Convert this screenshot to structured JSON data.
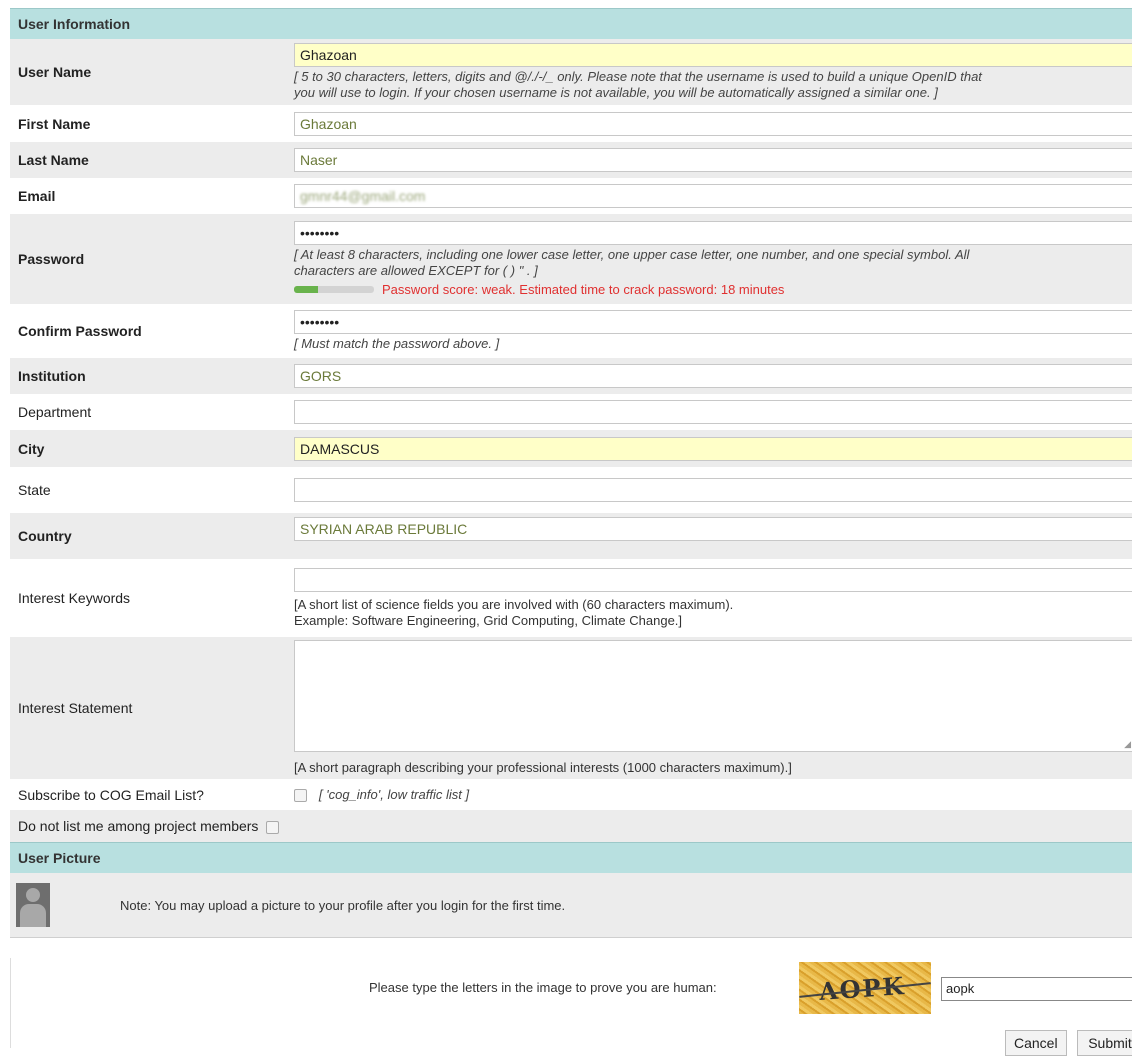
{
  "sections": {
    "user_information": "User Information",
    "user_picture": "User Picture"
  },
  "fields": {
    "username": {
      "label": "User Name",
      "value": "Ghazoan",
      "hint_line1": "[ 5 to 30 characters, letters, digits and @/./-/_ only. Please note that the username is used to build a unique OpenID that",
      "hint_line2": "you will use to login. If your chosen username is not available, you will be automatically assigned a similar one. ]"
    },
    "first_name": {
      "label": "First Name",
      "value": "Ghazoan"
    },
    "last_name": {
      "label": "Last Name",
      "value": "Naser"
    },
    "email": {
      "label": "Email",
      "value": "gmnr44@gmail.com"
    },
    "password": {
      "label": "Password",
      "value": "••••••••",
      "hint_line1": "[ At least 8 characters, including one lower case letter, one upper case letter, one number, and one special symbol. All",
      "hint_line2": "characters are allowed EXCEPT for ( ) \" . ]",
      "strength_text": "Password score: weak.  Estimated time to crack password: 18 minutes",
      "strength_fraction": 0.3
    },
    "confirm_password": {
      "label": "Confirm Password",
      "value": "••••••••",
      "hint": "[ Must match the password above. ]"
    },
    "institution": {
      "label": "Institution",
      "value": "GORS"
    },
    "department": {
      "label": "Department",
      "value": ""
    },
    "city": {
      "label": "City",
      "value": "DAMASCUS"
    },
    "state": {
      "label": "State",
      "value": ""
    },
    "country": {
      "label": "Country",
      "value": "SYRIAN ARAB REPUBLIC"
    },
    "interest_keywords": {
      "label": "Interest Keywords",
      "value": "",
      "hint_line1": "[A short list of science fields you are involved with (60 characters maximum).",
      "hint_line2": "Example: Software Engineering, Grid Computing, Climate Change.]"
    },
    "interest_statement": {
      "label": "Interest Statement",
      "value": "",
      "hint": "[A short paragraph describing your professional interests (1000 characters maximum).]"
    },
    "subscribe": {
      "label": "Subscribe to COG Email List?",
      "hint": "[ 'cog_info', low traffic list ]",
      "checked": false
    },
    "do_not_list": {
      "label": "Do not list me among project members",
      "checked": false
    }
  },
  "picture": {
    "note": "Note: You may upload a picture to your profile after you login for the first time."
  },
  "captcha": {
    "label": "Please type the letters in the image to prove you are human:",
    "image_text": "AOPK",
    "value": "aopk"
  },
  "buttons": {
    "cancel": "Cancel",
    "submit": "Submit"
  },
  "colors": {
    "section_header": "#b8e0e0",
    "autofill_yellow": "#ffffc8",
    "error_red": "#e03030",
    "meter_green": "#69b34c"
  }
}
